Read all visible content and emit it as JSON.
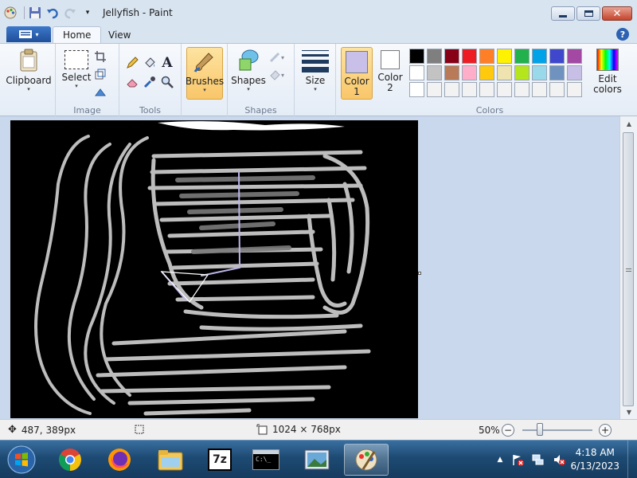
{
  "window": {
    "title": "Jellyfish - Paint"
  },
  "tabs": {
    "home": "Home",
    "view": "View"
  },
  "ribbon": {
    "clipboard": {
      "label": "Clipboard",
      "group": ""
    },
    "image": {
      "select_label": "Select",
      "group": "Image"
    },
    "tools": {
      "group": "Tools"
    },
    "brushes": {
      "label": "Brushes"
    },
    "shapes": {
      "label": "Shapes",
      "group": "Shapes"
    },
    "size": {
      "label": "Size"
    },
    "color1": {
      "label_line1": "Color",
      "label_line2": "1",
      "value": "#c8c0e8"
    },
    "color2": {
      "label_line1": "Color",
      "label_line2": "2",
      "value": "#ffffff"
    },
    "colors": {
      "group": "Colors"
    },
    "edit_colors": {
      "label_line1": "Edit",
      "label_line2": "colors"
    },
    "palette": [
      "#000000",
      "#7f7f7f",
      "#880015",
      "#ed1c24",
      "#ff7f27",
      "#fff200",
      "#22b14c",
      "#00a2e8",
      "#3f48cc",
      "#a349a4",
      "#ffffff",
      "#c3c3c3",
      "#b97a57",
      "#ffaec9",
      "#ffc90e",
      "#efe4b0",
      "#b5e61d",
      "#99d9ea",
      "#7092be",
      "#c8bfe7",
      "#ffffff",
      "#f2f2f2",
      "#f2f2f2",
      "#f2f2f2",
      "#f2f2f2",
      "#f2f2f2",
      "#f2f2f2",
      "#f2f2f2",
      "#f2f2f2",
      "#f2f2f2"
    ]
  },
  "status": {
    "cursor_position": "487, 389px",
    "image_size": "1024 × 768px",
    "zoom": "50%",
    "zoom_fraction": 0.22
  },
  "taskbar": {
    "time": "4:18 AM",
    "date": "6/13/2023"
  },
  "colors": {
    "canvas_bg": "#000000",
    "stroke": "#bdbdbd",
    "stroke_dark": "#7a7a7a",
    "accent_stroke": "#b9b3e6"
  }
}
